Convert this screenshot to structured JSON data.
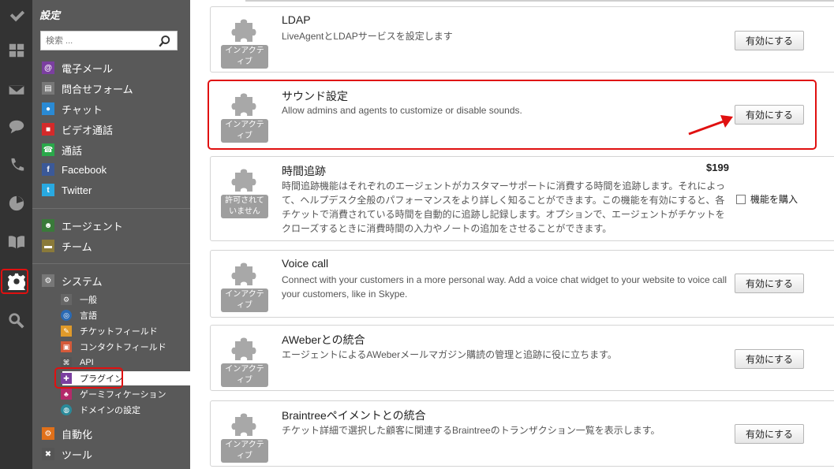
{
  "rail": {
    "icons": [
      "check-icon",
      "dashboard-icon",
      "mail-icon",
      "chat-icon",
      "phone-icon",
      "reports-icon",
      "knowledgebase-icon",
      "settings-icon",
      "search-icon"
    ]
  },
  "sidebar": {
    "title": "設定",
    "search_placeholder": "検索 ...",
    "channels": [
      {
        "label": "電子メール",
        "icon": "email-icon",
        "color": "#7b3fa0"
      },
      {
        "label": "問合せフォーム",
        "icon": "contact-form-icon",
        "color": "#777777"
      },
      {
        "label": "チャット",
        "icon": "chat-icon",
        "color": "#2a8ad4"
      },
      {
        "label": "ビデオ通話",
        "icon": "video-call-icon",
        "color": "#d42a2a"
      },
      {
        "label": "通話",
        "icon": "call-icon",
        "color": "#2aa84a"
      },
      {
        "label": "Facebook",
        "icon": "facebook-icon",
        "color": "#3b5998"
      },
      {
        "label": "Twitter",
        "icon": "twitter-icon",
        "color": "#29a9e1"
      }
    ],
    "people": [
      {
        "label": "エージェント",
        "icon": "agents-icon",
        "color": "#3a7a3a"
      },
      {
        "label": "チーム",
        "icon": "teams-icon",
        "color": "#8a7a3a"
      }
    ],
    "system": {
      "label": "システム",
      "items": [
        {
          "label": "一般",
          "icon": "general-icon"
        },
        {
          "label": "言語",
          "icon": "language-icon"
        },
        {
          "label": "チケットフィールド",
          "icon": "ticket-fields-icon"
        },
        {
          "label": "コンタクトフィールド",
          "icon": "contact-fields-icon"
        },
        {
          "label": "API",
          "icon": "api-icon"
        },
        {
          "label": "プラグイン",
          "icon": "plugin-icon"
        },
        {
          "label": "ゲーミフィケーション",
          "icon": "gamification-icon"
        },
        {
          "label": "ドメインの設定",
          "icon": "domain-icon"
        }
      ]
    },
    "automation": "自動化",
    "tools": "ツール"
  },
  "plugins": [
    {
      "title": "LDAP",
      "desc": "LiveAgentとLDAPサービスを設定します",
      "badge": "インアクティブ",
      "button": "有効にする"
    },
    {
      "title": "サウンド設定",
      "desc": "Allow admins and agents to customize or disable sounds.",
      "badge": "インアクティブ",
      "button": "有効にする"
    },
    {
      "title": "時間追跡",
      "desc": "時間追跡機能はそれぞれのエージェントがカスタマーサポートに消費する時間を追跡します。それによって、ヘルプデスク全般のパフォーマンスをより詳しく知ることができます。この機能を有効にすると、各チケットで消費されている時間を自動的に追跡し記録します。オプションで、エージェントがチケットをクローズするときに消費時間の入力やノートの追加をさせることができます。",
      "badge": "許可されていません",
      "price": "$199",
      "buy_label": "機能を購入"
    },
    {
      "title": "Voice call",
      "desc": "Connect with your customers in a more personal way. Add a voice chat widget to your website to voice call your customers, like in Skype.",
      "badge": "インアクティブ",
      "button": "有効にする"
    },
    {
      "title": "AWeberとの統合",
      "desc": "エージェントによるAWeberメールマガジン購読の管理と追跡に役に立ちます。",
      "badge": "インアクティブ",
      "button": "有効にする"
    },
    {
      "title": "Braintreeペイメントとの統合",
      "desc": "チケット詳細で選択した顧客に関連するBraintreeのトランザクション一覧を表示します。",
      "badge": "インアクティブ",
      "button": "有効にする"
    }
  ],
  "colors": {
    "highlight": "#e01010",
    "sidebar_bg": "#595959",
    "rail_bg": "#333333",
    "badge_bg": "#9e9e9e"
  }
}
